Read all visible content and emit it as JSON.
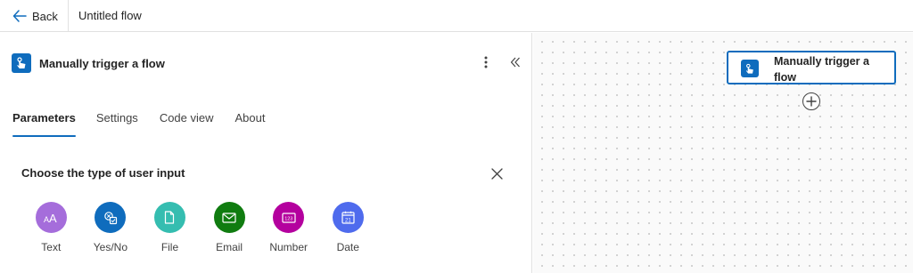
{
  "topbar": {
    "back_label": "Back",
    "flow_title": "Untitled flow"
  },
  "panel": {
    "title": "Manually trigger a flow",
    "tabs": [
      {
        "label": "Parameters",
        "active": true
      },
      {
        "label": "Settings",
        "active": false
      },
      {
        "label": "Code view",
        "active": false
      },
      {
        "label": "About",
        "active": false
      }
    ],
    "input_chooser": {
      "title": "Choose the type of user input",
      "types": [
        {
          "label": "Text",
          "icon": "text-icon",
          "color": "#a56ddb"
        },
        {
          "label": "Yes/No",
          "icon": "yes-no-icon",
          "color": "#0f6cbd"
        },
        {
          "label": "File",
          "icon": "file-icon",
          "color": "#35bdb0"
        },
        {
          "label": "Email",
          "icon": "email-icon",
          "color": "#107c10"
        },
        {
          "label": "Number",
          "icon": "number-icon",
          "color": "#b4009e"
        },
        {
          "label": "Date",
          "icon": "date-icon",
          "color": "#4f6bed"
        }
      ]
    }
  },
  "canvas": {
    "node_title": "Manually trigger a flow"
  },
  "colors": {
    "accent": "#0f6cbd"
  }
}
